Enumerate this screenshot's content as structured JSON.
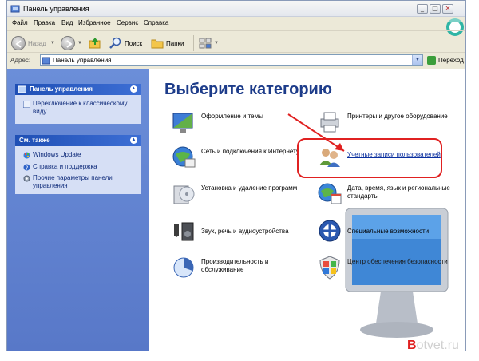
{
  "window": {
    "title": "Панель управления",
    "controls": {
      "minimize": "_",
      "maximize": "□",
      "close": "✕"
    }
  },
  "menu": [
    "Файл",
    "Правка",
    "Вид",
    "Избранное",
    "Сервис",
    "Справка"
  ],
  "toolbar": {
    "back_label": "Назад",
    "search_label": "Поиск",
    "folders_label": "Папки"
  },
  "address": {
    "label": "Адрес:",
    "value": "Панель управления",
    "go_label": "Переход"
  },
  "sidebar": {
    "panel1": {
      "title": "Панель управления",
      "links": [
        {
          "text": "Переключение к классическому виду",
          "icon": "classic-view-icon"
        }
      ]
    },
    "panel2": {
      "title": "См. также",
      "links": [
        {
          "text": "Windows Update",
          "icon": "windows-update-icon"
        },
        {
          "text": "Справка и поддержка",
          "icon": "help-icon"
        },
        {
          "text": "Прочие параметры панели управления",
          "icon": "settings-icon"
        }
      ]
    }
  },
  "main": {
    "heading": "Выберите категорию",
    "categories": [
      {
        "label": "Оформление и темы",
        "icon": "appearance-icon"
      },
      {
        "label": "Принтеры и другое оборудование",
        "icon": "printer-icon"
      },
      {
        "label": "Сеть и подключения к Интернету",
        "icon": "network-icon"
      },
      {
        "label": "Учетные записи пользователей",
        "icon": "user-accounts-icon"
      },
      {
        "label": "Установка и удаление программ",
        "icon": "programs-icon"
      },
      {
        "label": "Дата, время, язык и региональные стандарты",
        "icon": "date-time-icon"
      },
      {
        "label": "Звук, речь и аудиоустройства",
        "icon": "sound-icon"
      },
      {
        "label": "Специальные возможности",
        "icon": "accessibility-icon"
      },
      {
        "label": "Производительность и обслуживание",
        "icon": "performance-icon"
      },
      {
        "label": "Центр обеспечения безопасности",
        "icon": "security-center-icon"
      }
    ]
  },
  "watermark": {
    "first": "B",
    "rest": "otvet.ru"
  },
  "colors": {
    "sidebar": "#5878c8",
    "panel_header": "#1f4fb5",
    "heading": "#1d3c8a",
    "highlight": "#e02121"
  }
}
